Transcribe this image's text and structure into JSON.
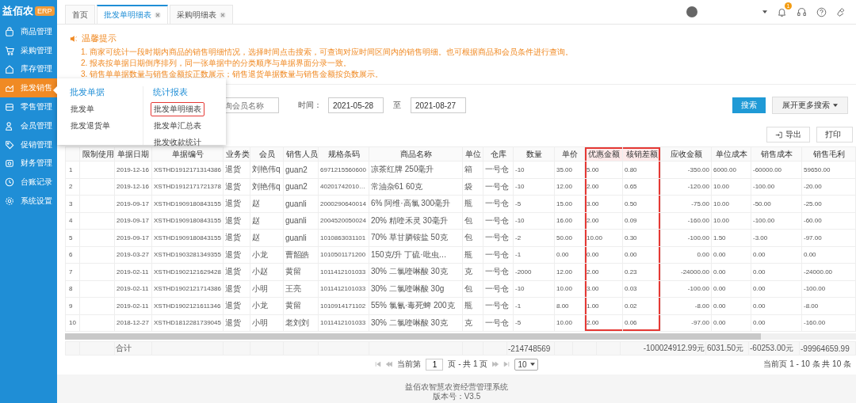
{
  "brand": {
    "name": "益佰农",
    "badge": "ERP"
  },
  "sidebar": {
    "items": [
      {
        "label": "商品管理",
        "selected": false
      },
      {
        "label": "采购管理",
        "selected": false
      },
      {
        "label": "库存管理",
        "selected": false
      },
      {
        "label": "批发销售",
        "selected": true
      },
      {
        "label": "零售管理",
        "selected": false
      },
      {
        "label": "会员管理",
        "selected": false
      },
      {
        "label": "促销管理",
        "selected": false
      },
      {
        "label": "财务管理",
        "selected": false
      },
      {
        "label": "台账记录",
        "selected": false
      },
      {
        "label": "系统设置",
        "selected": false
      }
    ]
  },
  "tabs": [
    {
      "label": "首页",
      "selected": false,
      "closable": false
    },
    {
      "label": "批发单明细表",
      "selected": true,
      "closable": true
    },
    {
      "label": "采购明细表",
      "selected": false,
      "closable": true
    }
  ],
  "user_bar": {
    "notification_count": "1"
  },
  "notice": {
    "title": "温馨提示",
    "lines": [
      "1. 商家可统计一段时期内商品的销售明细情况，选择时间点击搜索，可查询对应时间区间内的销售明细。也可根据商品和会员条件进行查询。",
      "2. 报表按单据日期倒序排列，同一张单据中的分类顺序与单据界面分录一致。",
      "3. 销售单单据数量与销售金额按正数展示；销售退货单据数量与销售金额按负数展示。"
    ]
  },
  "menu_dropdown": {
    "groups": [
      {
        "title": "批发单据",
        "items": [
          {
            "label": "批发单",
            "highlighted": false
          },
          {
            "label": "批发退货单",
            "highlighted": false
          }
        ]
      },
      {
        "title": "统计报表",
        "items": [
          {
            "label": "批发单明细表",
            "highlighted": true
          },
          {
            "label": "批发单汇总表",
            "highlighted": false
          },
          {
            "label": "批发收款统计",
            "highlighted": false
          }
        ]
      }
    ]
  },
  "filters": {
    "member": {
      "placeholder": "询会员名称"
    },
    "time_label": "时间：",
    "date_from": "2021-05-28",
    "range_separator": "至",
    "date_to": "2021-08-27",
    "search_button": "搜索",
    "more_button": "展开更多搜索"
  },
  "toolbar": {
    "export": "导出",
    "print": "打印"
  },
  "table": {
    "columns": [
      {
        "label": "限制使用",
        "kind": "text",
        "highlighted": false
      },
      {
        "label": "单据日期",
        "kind": "num",
        "highlighted": false,
        "total": "合计"
      },
      {
        "label": "单据编号",
        "kind": "num",
        "highlighted": false
      },
      {
        "label": "业务类",
        "kind": "text",
        "highlighted": false
      },
      {
        "label": "会员",
        "kind": "text",
        "highlighted": false
      },
      {
        "label": "销售人员",
        "kind": "text",
        "highlighted": false
      },
      {
        "label": "规格条码",
        "kind": "num",
        "highlighted": false
      },
      {
        "label": "商品名称",
        "kind": "text",
        "highlighted": false
      },
      {
        "label": "单位",
        "kind": "text",
        "highlighted": false
      },
      {
        "label": "仓库",
        "kind": "text",
        "highlighted": false
      },
      {
        "label": "数量",
        "kind": "num",
        "highlighted": false,
        "total": "-214748569"
      },
      {
        "label": "单价",
        "kind": "num",
        "highlighted": false
      },
      {
        "label": "优惠金额",
        "kind": "num",
        "highlighted": true
      },
      {
        "label": "核销差额",
        "kind": "num",
        "highlighted": true
      },
      {
        "label": "应收金额",
        "kind": "amount",
        "highlighted": false,
        "total": "-100024912.99元"
      },
      {
        "label": "单位成本",
        "kind": "num",
        "highlighted": false,
        "total": "6031.50元"
      },
      {
        "label": "销售成本",
        "kind": "num",
        "highlighted": false,
        "total": "-60253.00元"
      },
      {
        "label": "销售毛利",
        "kind": "num",
        "highlighted": false,
        "total": "-99964659.99"
      }
    ],
    "rows": [
      {
        "no": "1",
        "cells": [
          "",
          "2019-12-16",
          "XSTHD1912171314386",
          "退货",
          "刘艳伟q",
          "guan2",
          "6971215560600",
          "凉茶红牌 250毫升",
          "箱",
          "一号仓",
          "-10",
          "35.00",
          "5.00",
          "0.80",
          "-350.00",
          "6000.00",
          "-60000.00",
          "59650.00"
        ]
      },
      {
        "no": "2",
        "cells": [
          "",
          "2019-12-16",
          "XSTHD1912171721378",
          "退货",
          "刘艳伟q",
          "guan2",
          "40201742010…",
          "常油杂61 60克",
          "袋",
          "一号仓",
          "-10",
          "12.00",
          "2.00",
          "0.65",
          "-120.00",
          "10.00",
          "-100.00",
          "-20.00"
        ]
      },
      {
        "no": "3",
        "cells": [
          "",
          "2019-09-17",
          "XSTHD1909180843155",
          "退货",
          "赵",
          "guanli",
          "2000290640014",
          "6% 阿维·高氯 300毫升",
          "瓶",
          "一号仓",
          "-5",
          "15.00",
          "3.00",
          "0.50",
          "-75.00",
          "10.00",
          "-50.00",
          "-25.00"
        ]
      },
      {
        "no": "4",
        "cells": [
          "",
          "2019-09-17",
          "XSTHD1909180843155",
          "退货",
          "赵",
          "guanli",
          "2004520050024",
          "20% 精喹禾灵 30毫升",
          "包",
          "一号仓",
          "-10",
          "16.00",
          "2.00",
          "0.09",
          "-160.00",
          "10.00",
          "-100.00",
          "-60.00"
        ]
      },
      {
        "no": "5",
        "cells": [
          "",
          "2019-09-17",
          "XSTHD1909180843155",
          "退货",
          "赵",
          "guanli",
          "1010863031101",
          "70% 草甘膦铵盐 50克",
          "包",
          "一号仓",
          "-2",
          "50.00",
          "10.00",
          "0.30",
          "-100.00",
          "1.50",
          "-3.00",
          "-97.00"
        ]
      },
      {
        "no": "6",
        "cells": [
          "",
          "2019-03-27",
          "XSTHD1903281349355",
          "退货",
          "小龙",
          "曹韶皓",
          "1010501171200",
          "150克/升 丁硫·吡虫…",
          "瓶",
          "一号仓",
          "-1",
          "0.00",
          "0.00",
          "0.00",
          "0.00",
          "0.00",
          "0.00",
          "0.00"
        ]
      },
      {
        "no": "7",
        "cells": [
          "",
          "2019-02-11",
          "XSTHD1902121629428",
          "退货",
          "小赵",
          "黄留",
          "1011412101033",
          "30% 二氯喹啉酸 30克",
          "克",
          "一号仓",
          "-2000",
          "12.00",
          "2.00",
          "0.23",
          "-24000.00",
          "0.00",
          "0.00",
          "-24000.00"
        ]
      },
      {
        "no": "8",
        "cells": [
          "",
          "2019-02-11",
          "XSTHD1902121714386",
          "退货",
          "小明",
          "王亮",
          "1011412101033",
          "30% 二氯喹啉酸 30g",
          "包",
          "一号仓",
          "-10",
          "10.00",
          "3.00",
          "0.03",
          "-100.00",
          "0.00",
          "0.00",
          "-100.00"
        ]
      },
      {
        "no": "9",
        "cells": [
          "",
          "2019-02-11",
          "XSTHD1902121611346",
          "退货",
          "小龙",
          "黄留",
          "1010914171102",
          "55% 氯氰·毒死蜱 200克",
          "瓶",
          "一号仓",
          "-1",
          "8.00",
          "1.00",
          "0.02",
          "-8.00",
          "0.00",
          "0.00",
          "-8.00"
        ]
      },
      {
        "no": "10",
        "cells": [
          "",
          "2018-12-27",
          "XSTHD1812281739045",
          "退货",
          "小明",
          "老刘刘",
          "1011412101033",
          "30% 二氯喹啉酸 30克",
          "克",
          "一号仓",
          "-5",
          "10.00",
          "2.00",
          "0.06",
          "-97.00",
          "0.00",
          "0.00",
          "-160.00"
        ]
      }
    ]
  },
  "pagination": {
    "current_label": "当前第",
    "page": "1",
    "total_label": "页 - 共 1 页",
    "page_size": "10",
    "summary": "当前页 1 - 10 条  共 10 条"
  },
  "footer": {
    "system_name": "益佰农智慧农资经营管理系统",
    "version": "版本号：V3.5"
  }
}
